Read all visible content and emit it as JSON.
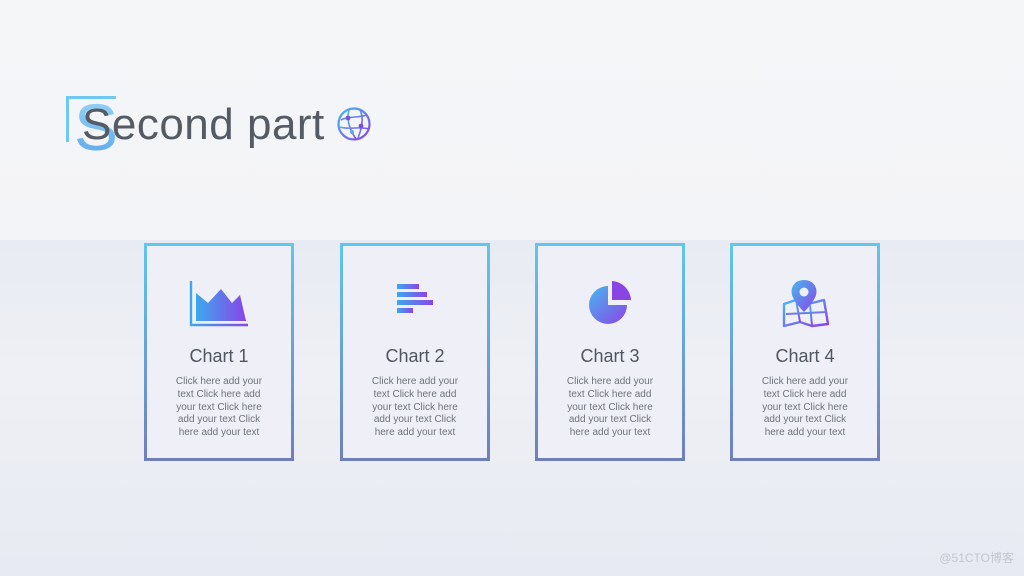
{
  "header": {
    "title_letter": "S",
    "title_rest": "econd part",
    "title_icon": "globe-network-icon"
  },
  "cards": [
    {
      "title": "Chart 1",
      "text": "Click here add your text Click here add your text Click here add your text Click here add your text",
      "icon": "area-chart-icon"
    },
    {
      "title": "Chart 2",
      "text": "Click here add your text Click here add your text Click here add your text Click here add your text",
      "icon": "horizontal-bar-chart-icon"
    },
    {
      "title": "Chart 3",
      "text": "Click here add your text Click here add your text Click here add your text Click here add your text",
      "icon": "pie-chart-icon"
    },
    {
      "title": "Chart 4",
      "text": "Click here add your text Click here add your text Click here add your text Click here add your text",
      "icon": "map-pin-icon"
    }
  ],
  "watermark": "@51CTO博客",
  "colors": {
    "accent_cyan": "#5fc6ee",
    "accent_purple": "#7a4fe0",
    "frame_bottom": "#6f7fbc",
    "title_text": "#555b64"
  }
}
